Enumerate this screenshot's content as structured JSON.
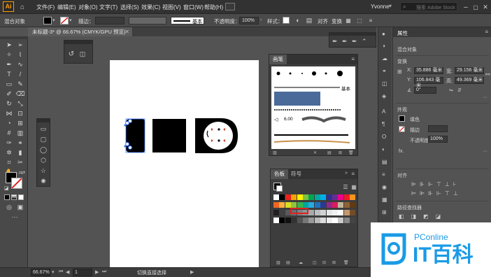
{
  "app": {
    "logo": "Ai",
    "menus": [
      "文件(F)",
      "编辑(E)",
      "对象(O)",
      "文字(T)",
      "选择(S)",
      "效果(C)",
      "视图(V)",
      "窗口(W)",
      "帮助(H)"
    ],
    "user": "Yvonne",
    "search_placeholder": "搜索 Adobe Stock"
  },
  "control_bar": {
    "object_label": "混合对象",
    "stroke_label": "描边：",
    "stroke_style": "基本",
    "opacity_label": "不透明度：",
    "opacity_value": "100%",
    "style_label": "样式：",
    "align_label": "对齐",
    "transform_label": "变换"
  },
  "document": {
    "tab_title": "未标题-3* @ 66.67% (CMYK/GPU 预览)"
  },
  "brushes_panel": {
    "title": "画笔",
    "basic_label": "基本",
    "size_label": "6.00"
  },
  "swatches_panel": {
    "tab_swatches": "色板",
    "tab_symbols": "符号"
  },
  "properties_panel": {
    "tab_label": "属性",
    "object_type": "混合对象",
    "transform_heading": "变换",
    "x_label": "X:",
    "x_value": "35.886 毫米",
    "y_label": "Y:",
    "y_value": "106.843 毫米",
    "w_label": "宽:",
    "w_value": "29.156 毫米",
    "h_label": "高:",
    "h_value": "49.369 毫米",
    "angle_value": "0°",
    "appearance_heading": "外观",
    "fill_label": "填色",
    "stroke_label": "描边",
    "opacity_label": "不透明度",
    "opacity_value": "100%",
    "fx_label": "fx.",
    "align_heading": "对齐",
    "quick_actions_heading": "路径查找器"
  },
  "status_bar": {
    "zoom": "66.67%",
    "page": "1",
    "hint": "切换直接选择"
  },
  "watermark": {
    "brand": "PConline",
    "logo_text": "IT百科"
  },
  "colors": {
    "accent_orange": "#ff9a00",
    "selection_blue": "#3a78ff",
    "mask_red": "#c43a22"
  }
}
